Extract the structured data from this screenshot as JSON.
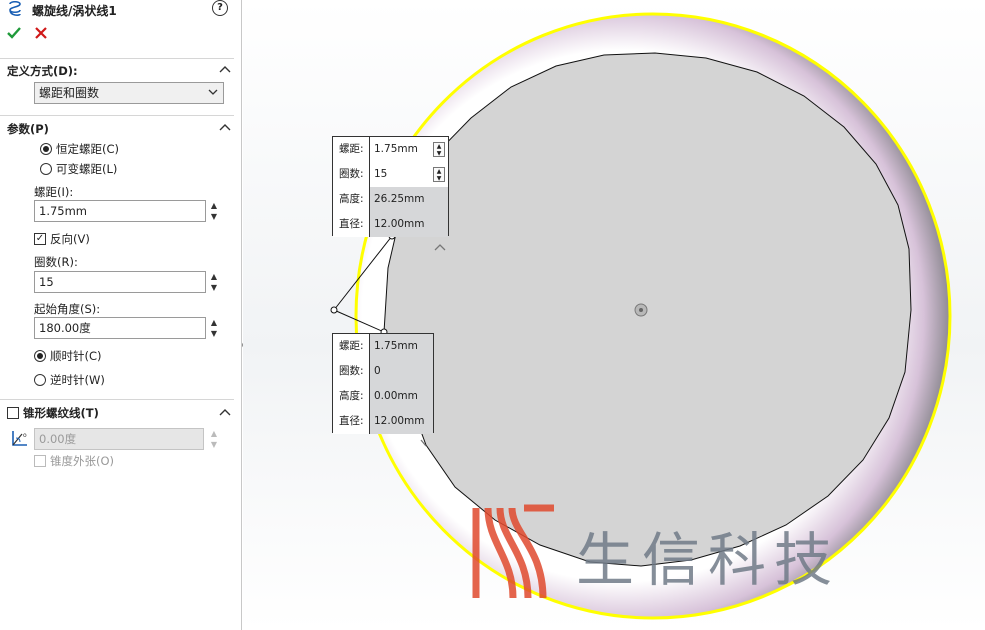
{
  "feature": {
    "title": "螺旋线/涡状线1",
    "help": "?"
  },
  "definition": {
    "section_label": "定义方式(D):",
    "method_value": "螺距和圈数"
  },
  "params": {
    "section_label": "参数(P)",
    "radio_constant": "恒定螺距(C)",
    "radio_variable": "可变螺距(L)",
    "pitch_label": "螺距(I):",
    "pitch_value": "1.75mm",
    "reverse_label": "反向(V)",
    "revolutions_label": "圈数(R):",
    "revolutions_value": "15",
    "start_angle_label": "起始角度(S):",
    "start_angle_value": "180.00度",
    "clockwise_label": "顺时针(C)",
    "counterclockwise_label": "逆时针(W)"
  },
  "taper": {
    "section_label": "锥形螺纹线(T)",
    "angle_value": "0.00度",
    "taper_outward_label": "锥度外张(O)"
  },
  "callout_top": {
    "rows": [
      {
        "key": "螺距:",
        "value": "1.75mm"
      },
      {
        "key": "圈数:",
        "value": "15"
      },
      {
        "key": "高度:",
        "value": "26.25mm"
      },
      {
        "key": "直径:",
        "value": "12.00mm"
      }
    ]
  },
  "callout_bottom": {
    "rows": [
      {
        "key": "螺距:",
        "value": "1.75mm"
      },
      {
        "key": "圈数:",
        "value": "0"
      },
      {
        "key": "高度:",
        "value": "0.00mm"
      },
      {
        "key": "直径:",
        "value": "12.00mm"
      }
    ]
  },
  "watermark": {
    "text": "生信科技"
  },
  "colors": {
    "accept": "#1f9a3a",
    "cancel": "#d01818",
    "edge_highlight": "#ffff00",
    "face_grey": "#d4d4d4",
    "watermark_red": "#e04a2e"
  }
}
